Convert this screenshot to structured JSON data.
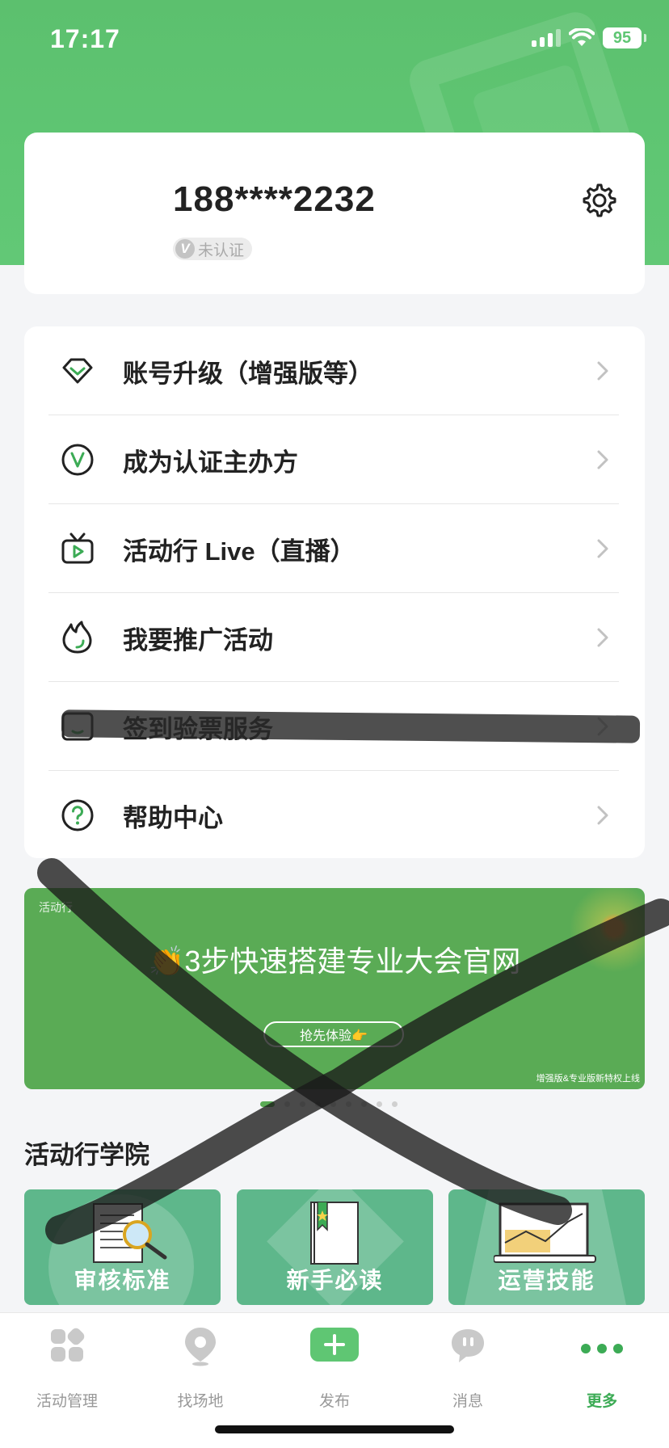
{
  "status_bar": {
    "time": "17:17",
    "battery": "95"
  },
  "profile": {
    "phone": "188****2232",
    "verify_status": "未认证",
    "verify_letter": "V"
  },
  "menu": {
    "items": [
      {
        "label": "账号升级（增强版等）",
        "icon": "diamond-icon"
      },
      {
        "label": "成为认证主办方",
        "icon": "verified-v-icon"
      },
      {
        "label": "活动行 Live（直播）",
        "icon": "tv-play-icon"
      },
      {
        "label": "我要推广活动",
        "icon": "flame-icon"
      },
      {
        "label": "签到验票服务",
        "icon": "ticket-scan-icon"
      },
      {
        "label": "帮助中心",
        "icon": "help-circle-icon"
      }
    ]
  },
  "banner": {
    "brand": "活动行",
    "title": "👏3步快速搭建专业大会官网",
    "button": "抢先体验👉",
    "note": "增强版&专业版新特权上线"
  },
  "academy": {
    "title": "活动行学院",
    "cards": [
      {
        "label": "审核标准",
        "icon": "document-magnifier-icon"
      },
      {
        "label": "新手必读",
        "icon": "book-icon"
      },
      {
        "label": "运营技能",
        "icon": "laptop-chart-icon"
      }
    ]
  },
  "tabbar": {
    "tabs": [
      {
        "label": "活动管理",
        "icon": "grid-icon",
        "active": false
      },
      {
        "label": "找场地",
        "icon": "location-pin-icon",
        "active": false
      },
      {
        "label": "发布",
        "icon": "plus-icon",
        "active": false
      },
      {
        "label": "消息",
        "icon": "chat-bubble-icon",
        "active": false
      },
      {
        "label": "更多",
        "icon": "more-dots-icon",
        "active": true
      }
    ]
  },
  "colors": {
    "brand_green": "#5fc673",
    "accent_green": "#3cab55",
    "banner_green": "#5aab55",
    "card_green": "#5eb78b"
  }
}
